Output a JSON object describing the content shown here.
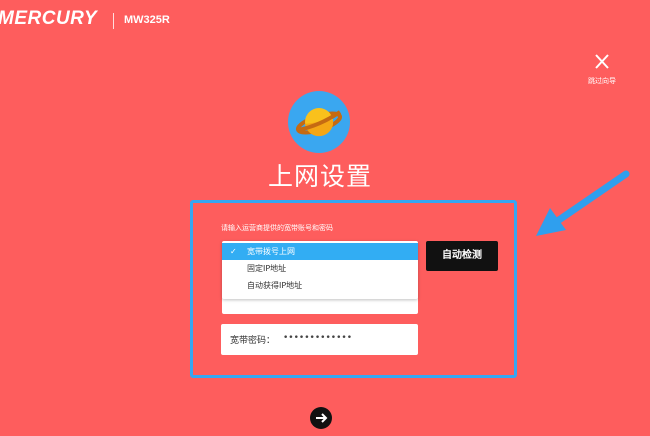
{
  "header": {
    "brand": "MERCURY",
    "model": "MW325R"
  },
  "skip": {
    "label": "跳过向导",
    "icon": "close-icon"
  },
  "page": {
    "title": "上网设置",
    "icon": "planet-icon"
  },
  "form": {
    "instruction": "请输入运营商提供的宽带账号和密码",
    "connection_options": [
      {
        "label": "宽带拨号上网",
        "selected": true
      },
      {
        "label": "固定IP地址",
        "selected": false
      },
      {
        "label": "自动获得IP地址",
        "selected": false
      }
    ],
    "check_mark": "✓",
    "password_label": "宽带密码：",
    "password_value": "•••••••••••••",
    "detect_button": "自动检测"
  },
  "next": {
    "icon": "arrow-right-icon"
  },
  "colors": {
    "background": "#fe5d5d",
    "accent": "#36a6f3",
    "button": "#111111"
  }
}
